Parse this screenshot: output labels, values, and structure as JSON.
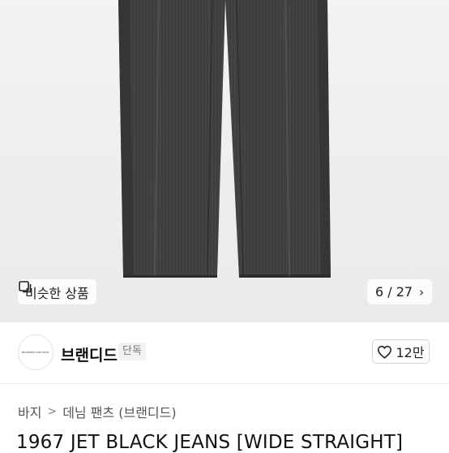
{
  "hero": {
    "image": "black-jeans-product-photo",
    "similar_label": "비슷한 상품",
    "similar_icon": "similar-products-icon",
    "pager": "6 / 27",
    "pager_icon": "chevron-right-icon"
  },
  "seller": {
    "logo_text": "BRANDED INDUSTRY",
    "name": "브랜디드",
    "badge": "단독",
    "like_icon": "heart-icon",
    "like_count": "12만"
  },
  "breadcrumb": {
    "items": [
      "바지",
      "데님 팬츠 (브랜디드)"
    ],
    "separator": ">"
  },
  "product": {
    "title": "1967 JET BLACK JEANS [WIDE STRAIGHT]"
  }
}
